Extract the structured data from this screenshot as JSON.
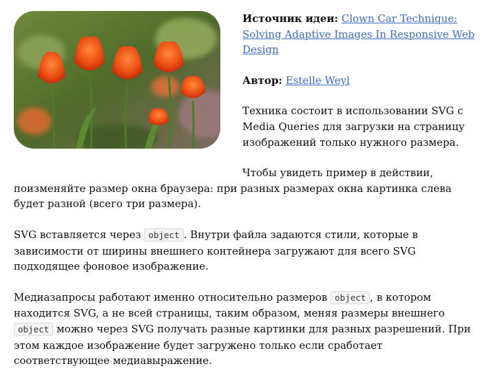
{
  "source": {
    "label": "Источник идеи:",
    "link_text": "Clown Car Technique: Solving Adaptive Images In Responsive Web Design"
  },
  "author": {
    "label": "Автор:",
    "link_text": "Estelle Weyl"
  },
  "image": {
    "icon": "tulips-photo"
  },
  "paragraphs": {
    "p1": "Техника состоит в использовании SVG с Media Queries для загрузки на страницу изображений только нужного размера.",
    "p2": "Чтобы увидеть пример в действии, поизменяйте размер окна браузера: при разных размерах окна картинка слева будет разной (всего три размера).",
    "p3_a": "SVG вставляется через",
    "p3_code": "object",
    "p3_b": ". Внутри файла задаются стили, которые в зависимости от ширины внешнего контейнера загружают для всего SVG подходящее фоновое изображение.",
    "p4_a": "Медиазапросы работают именно относительно размеров",
    "p4_code1": "object",
    "p4_b": ", в котором находится SVG, а не всей страницы, таким образом, меняя размеры внешнего",
    "p4_code2": "object",
    "p4_c": "можно через SVG получать разные картинки для разных разрешений. При этом каждое изображение будет загружено только если сработает соответствующее медиавыражение."
  }
}
